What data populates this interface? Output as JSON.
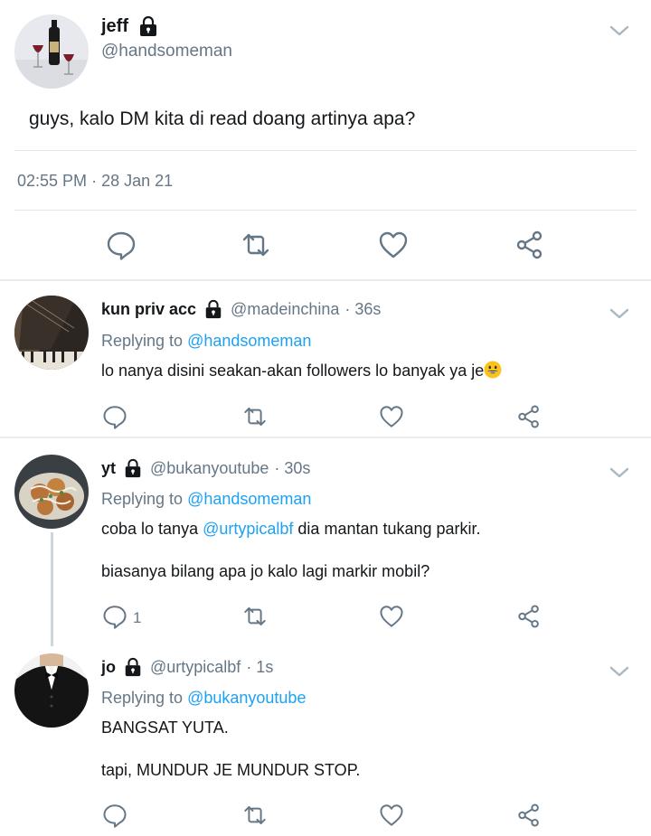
{
  "main_tweet": {
    "name": "jeff",
    "handle": "@handsomeman",
    "text": "guys, kalo DM kita di read doang artinya apa?",
    "time": "02:55 PM",
    "date": "28 Jan 21",
    "meta_sep": "·"
  },
  "replies": [
    {
      "name": "kun priv acc",
      "handle": "@madeinchina",
      "age": "· 36s",
      "replying_prefix": "Replying to",
      "replying_to": "@handsomeman",
      "text1": "lo nanya disini seakan-akan followers lo banyak ya je",
      "reply_count": ""
    },
    {
      "name": "yt",
      "handle": "@bukanyoutube",
      "age": "· 30s",
      "replying_prefix": "Replying to",
      "replying_to": "@handsomeman",
      "text1_pre": "coba lo tanya",
      "text1_mention": "@urtypicalbf",
      "text1_post": "dia mantan tukang parkir.",
      "text2": "biasanya bilang apa jo kalo lagi markir mobil?",
      "reply_count": "1"
    },
    {
      "name": "jo",
      "handle": "@urtypicalbf",
      "age": "· 1s",
      "replying_prefix": "Replying to",
      "replying_to": "@bukanyoutube",
      "text1": "BANGSAT YUTA.",
      "text2": "tapi, MUNDUR JE MUNDUR STOP.",
      "reply_count": ""
    }
  ],
  "icons": {
    "reply": "reply-icon",
    "retweet": "retweet-icon",
    "like": "heart-icon",
    "share": "share-icon",
    "lock": "lock-icon",
    "more": "chevron-down-icon",
    "emoji": "grinning-face-icon"
  },
  "colors": {
    "link": "#1da1f2",
    "secondary": "#657786",
    "icon": "#657786",
    "divider": "#e1e8ed"
  }
}
